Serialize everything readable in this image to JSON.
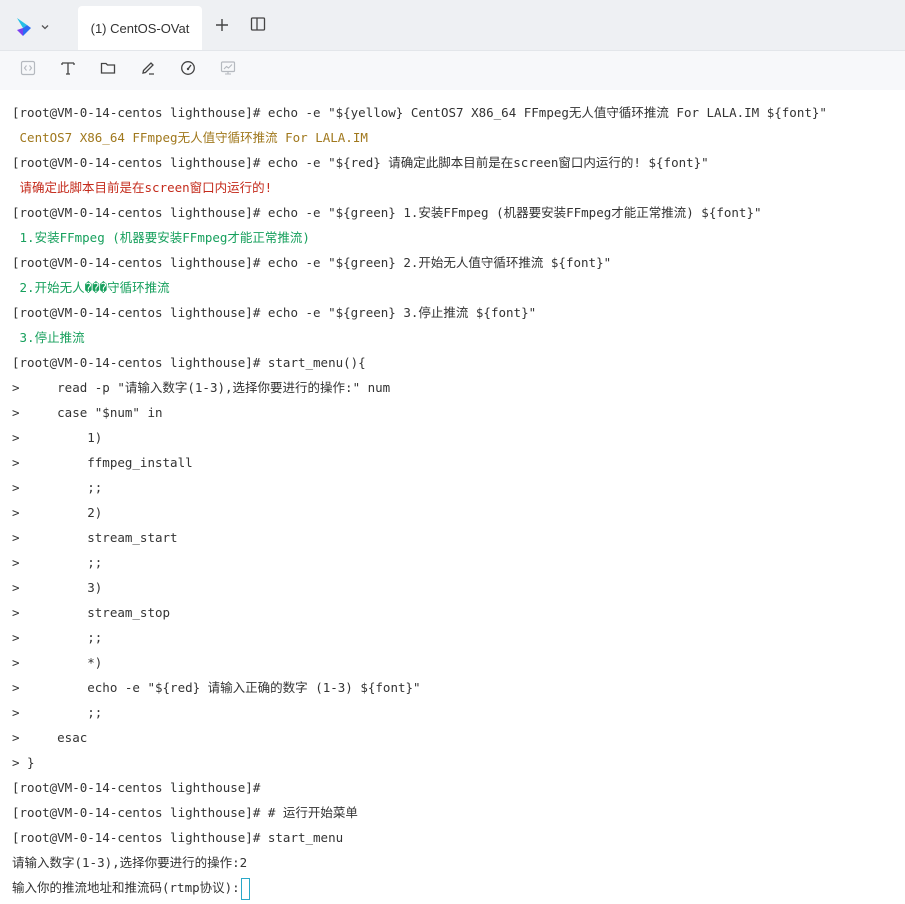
{
  "tabbar": {
    "tab_title": "(1) CentOS-OVat",
    "add_icon": "plus-icon",
    "split_icon": "split-view-icon",
    "logo_icon": "app-logo-icon",
    "menu_icon": "chevron-down-icon",
    "brand_colors": [
      "#26c0e6",
      "#2b6cf3",
      "#7b3ff0"
    ]
  },
  "toolbar": {
    "icons": [
      "code-icon",
      "text-icon",
      "folder-icon",
      "edit-icon",
      "speedometer-icon",
      "monitor-icon"
    ]
  },
  "colors": {
    "default": "#333333",
    "yellow": "#a0781d",
    "red": "#c42b1c",
    "green": "#17a05d",
    "cursor": "#2aa8c8"
  },
  "terminal": {
    "lines": [
      {
        "text": "[root@VM-0-14-centos lighthouse]# echo -e \"${yellow} CentOS7 X86_64 FFmpeg无人值守循环推流 For LALA.IM ${font}\"",
        "color": "default"
      },
      {
        "text": " CentOS7 X86_64 FFmpeg无人值守循环推流 For LALA.IM",
        "color": "yellow"
      },
      {
        "text": "[root@VM-0-14-centos lighthouse]# echo -e \"${red} 请确定此脚本目前是在screen窗口内运行的! ${font}\"",
        "color": "default"
      },
      {
        "text": " 请确定此脚本目前是在screen窗口内运行的!",
        "color": "red"
      },
      {
        "text": "[root@VM-0-14-centos lighthouse]# echo -e \"${green} 1.安装FFmpeg (机器要安装FFmpeg才能正常推流) ${font}\"",
        "color": "default"
      },
      {
        "text": " 1.安装FFmpeg (机器要安装FFmpeg才能正常推流)",
        "color": "green"
      },
      {
        "text": "[root@VM-0-14-centos lighthouse]# echo -e \"${green} 2.开始无人值守循环推流 ${font}\"",
        "color": "default"
      },
      {
        "text": " 2.开始无人���守循环推流",
        "color": "green"
      },
      {
        "text": "[root@VM-0-14-centos lighthouse]# echo -e \"${green} 3.停止推流 ${font}\"",
        "color": "default"
      },
      {
        "text": " 3.停止推流",
        "color": "green"
      },
      {
        "text": "[root@VM-0-14-centos lighthouse]# start_menu(){",
        "color": "default"
      },
      {
        "text": ">     read -p \"请输入数字(1-3),选择你要进行的操作:\" num",
        "color": "default"
      },
      {
        "text": ">     case \"$num\" in",
        "color": "default"
      },
      {
        "text": ">         1)",
        "color": "default"
      },
      {
        "text": ">         ffmpeg_install",
        "color": "default"
      },
      {
        "text": ">         ;;",
        "color": "default"
      },
      {
        "text": ">         2)",
        "color": "default"
      },
      {
        "text": ">         stream_start",
        "color": "default"
      },
      {
        "text": ">         ;;",
        "color": "default"
      },
      {
        "text": ">         3)",
        "color": "default"
      },
      {
        "text": ">         stream_stop",
        "color": "default"
      },
      {
        "text": ">         ;;",
        "color": "default"
      },
      {
        "text": ">         *)",
        "color": "default"
      },
      {
        "text": ">         echo -e \"${red} 请输入正确的数字 (1-3) ${font}\"",
        "color": "default"
      },
      {
        "text": ">         ;;",
        "color": "default"
      },
      {
        "text": ">     esac",
        "color": "default"
      },
      {
        "text": "> }",
        "color": "default"
      },
      {
        "text": "[root@VM-0-14-centos lighthouse]#",
        "color": "default"
      },
      {
        "text": "[root@VM-0-14-centos lighthouse]# # 运行开始菜单",
        "color": "default"
      },
      {
        "text": "[root@VM-0-14-centos lighthouse]# start_menu",
        "color": "default"
      },
      {
        "text": "请输入数字(1-3),选择你要进行的操作:2",
        "color": "default"
      },
      {
        "text": "输入你的推流地址和推流码(rtmp协议):",
        "color": "default",
        "cursor": true
      }
    ]
  }
}
